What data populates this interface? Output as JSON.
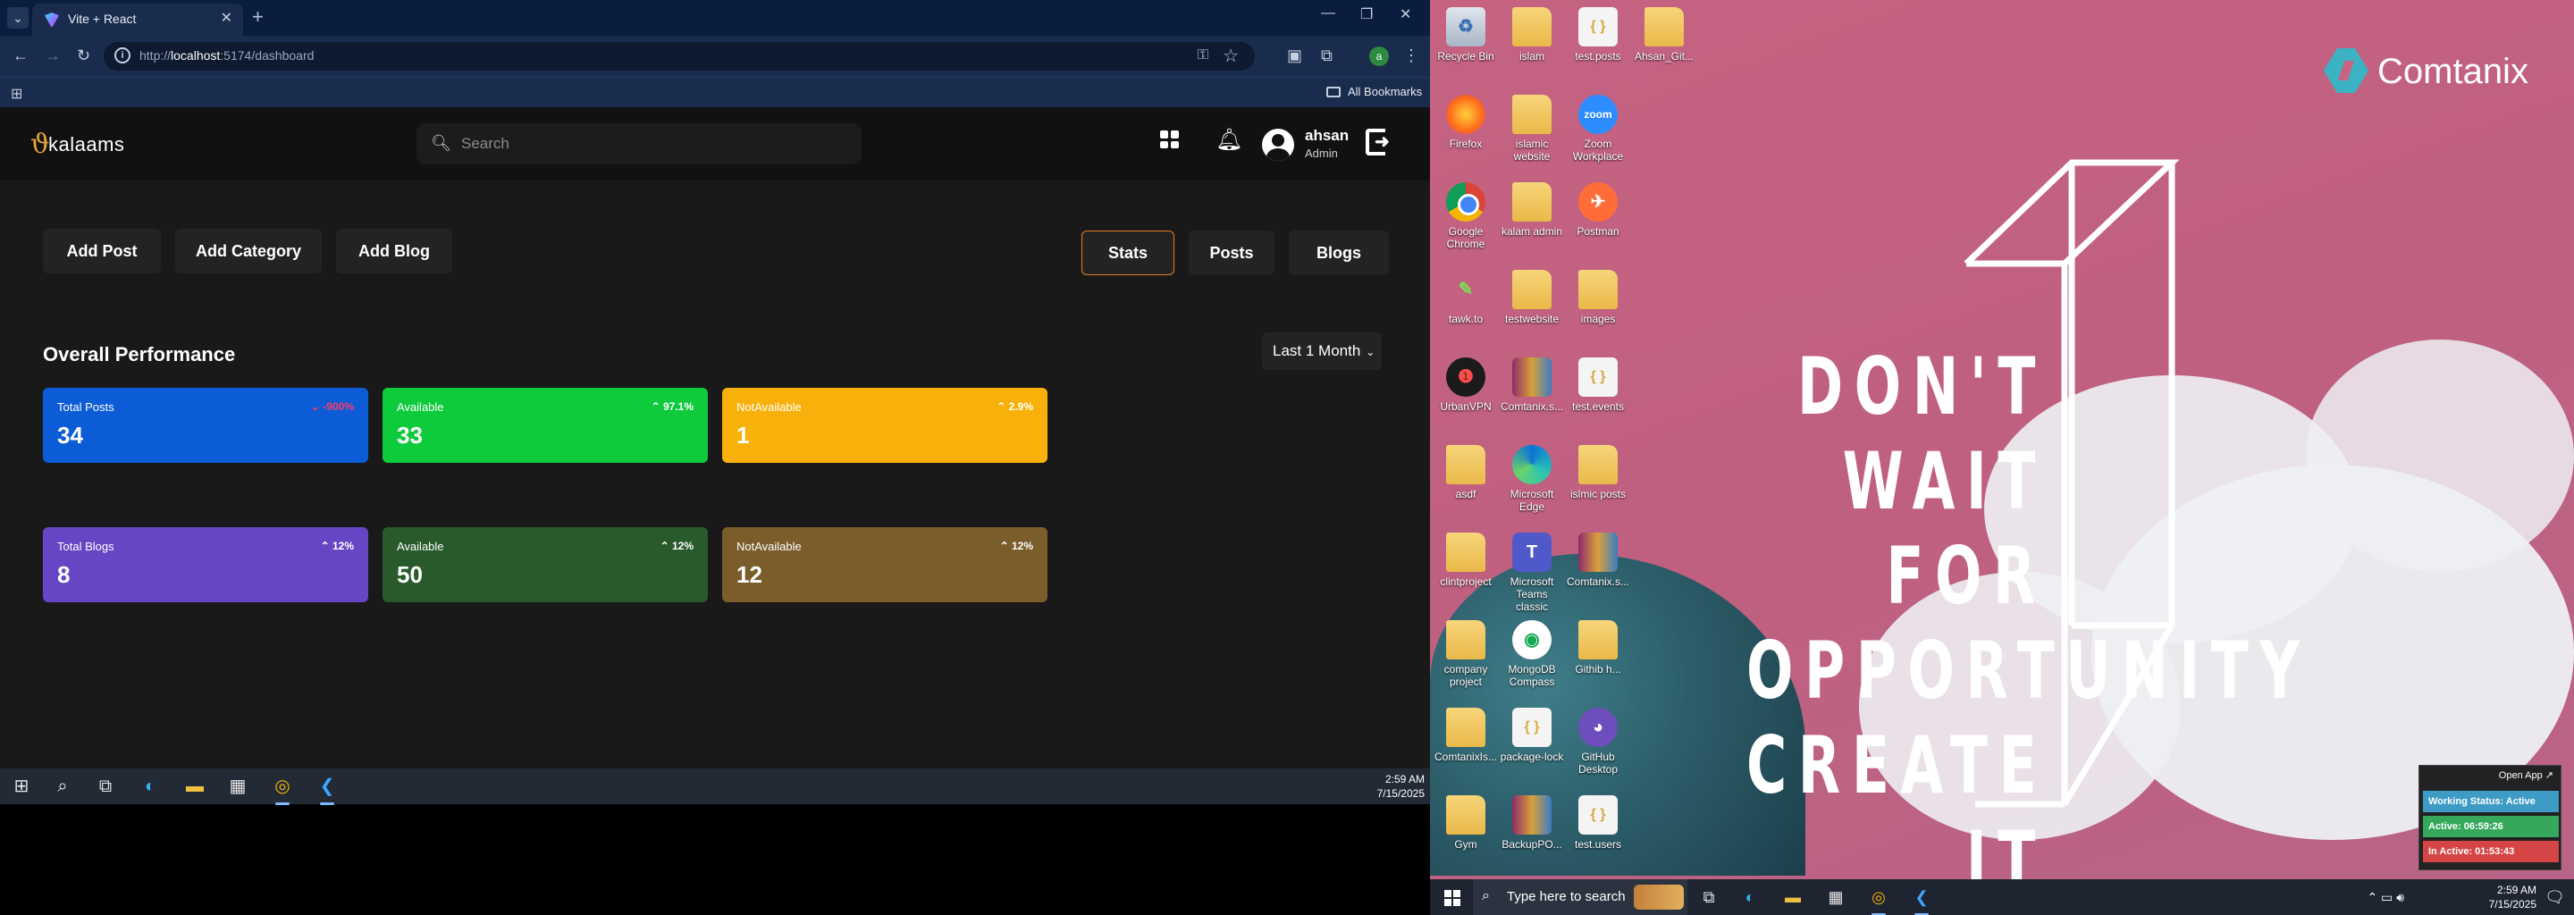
{
  "browser": {
    "tab_title": "Vite + React",
    "url_prefix": "http://",
    "url_host": "localhost",
    "url_path": ":5174/dashboard",
    "profile_initial": "a",
    "bookmarks_label": "All Bookmarks"
  },
  "app": {
    "logo_text": "kalaams",
    "search_placeholder": "Search",
    "user_name": "ahsan",
    "user_role": "Admin",
    "action_buttons": [
      "Add Post",
      "Add Category",
      "Add Blog"
    ],
    "tabs": [
      "Stats",
      "Posts",
      "Blogs"
    ],
    "active_tab": "Stats",
    "section_title": "Overall Performance",
    "range_label": "Last 1 Month",
    "cards": [
      {
        "label": "Total Posts",
        "value": "34",
        "change": "-900%",
        "trend": "down",
        "color": "#0b5cd6"
      },
      {
        "label": "Available",
        "value": "33",
        "change": "97.1%",
        "trend": "up",
        "color": "#0ecb3c"
      },
      {
        "label": "NotAvailable",
        "value": "1",
        "change": "2.9%",
        "trend": "up",
        "color": "#f7b10a"
      },
      {
        "label": "Total Blogs",
        "value": "8",
        "change": "12%",
        "trend": "up",
        "color": "#6646c4"
      },
      {
        "label": "Available",
        "value": "50",
        "change": "12%",
        "trend": "up",
        "color": "#295a2b"
      },
      {
        "label": "NotAvailable",
        "value": "12",
        "change": "12%",
        "trend": "up",
        "color": "#7b5d2c"
      }
    ]
  },
  "taskbar_left": {
    "time": "2:59 AM",
    "date": "7/15/2025"
  },
  "desktop": {
    "brand": "Comtanix",
    "quote_lines": [
      "DON'T",
      "WAIT FOR",
      "OPPORTUNITY",
      "CREATE IT"
    ],
    "icons": [
      {
        "label": "Recycle Bin",
        "kind": "bin",
        "glyph": "♻"
      },
      {
        "label": "islam",
        "kind": "folder",
        "glyph": ""
      },
      {
        "label": "test.posts",
        "kind": "file",
        "glyph": "{ }"
      },
      {
        "label": "Ahsan_Git...",
        "kind": "folder",
        "glyph": ""
      },
      {
        "label": "Firefox",
        "kind": "ff",
        "glyph": ""
      },
      {
        "label": "islamic website",
        "kind": "folder",
        "glyph": ""
      },
      {
        "label": "Zoom Workplace",
        "kind": "zoom",
        "glyph": "zoom"
      },
      {
        "label": "Google Chrome",
        "kind": "chrome",
        "glyph": ""
      },
      {
        "label": "kalam admin",
        "kind": "folder",
        "glyph": ""
      },
      {
        "label": "Postman",
        "kind": "postman",
        "glyph": "✈"
      },
      {
        "label": "tawk.to",
        "kind": "tawk",
        "glyph": "✎"
      },
      {
        "label": "testwebsite",
        "kind": "folder",
        "glyph": ""
      },
      {
        "label": "images",
        "kind": "folder",
        "glyph": ""
      },
      {
        "label": "UrbanVPN",
        "kind": "vpn",
        "glyph": "❶"
      },
      {
        "label": "Comtanix.s...",
        "kind": "rar",
        "glyph": ""
      },
      {
        "label": "test.events",
        "kind": "file",
        "glyph": "{ }"
      },
      {
        "label": "asdf",
        "kind": "folder",
        "glyph": ""
      },
      {
        "label": "Microsoft Edge",
        "kind": "edge",
        "glyph": ""
      },
      {
        "label": "islmic posts",
        "kind": "folder",
        "glyph": ""
      },
      {
        "label": "clintproject",
        "kind": "folder",
        "glyph": ""
      },
      {
        "label": "Microsoft Teams classic",
        "kind": "teams",
        "glyph": "T"
      },
      {
        "label": "Comtanix.s...",
        "kind": "rar",
        "glyph": ""
      },
      {
        "label": "company project",
        "kind": "folder",
        "glyph": ""
      },
      {
        "label": "MongoDB Compass",
        "kind": "mongo",
        "glyph": "◉"
      },
      {
        "label": "Githib h...",
        "kind": "folder",
        "glyph": ""
      },
      {
        "label": "ComtanixIs...",
        "kind": "folder",
        "glyph": ""
      },
      {
        "label": "package-lock",
        "kind": "file",
        "glyph": "{ }"
      },
      {
        "label": "GitHub Desktop",
        "kind": "gh",
        "glyph": "◕"
      },
      {
        "label": "Gym",
        "kind": "folder",
        "glyph": ""
      },
      {
        "label": "BackupPO...",
        "kind": "rar",
        "glyph": ""
      },
      {
        "label": "test.users",
        "kind": "file",
        "glyph": "{ }"
      }
    ]
  },
  "widget": {
    "open_app": "Open App ↗",
    "status": "Working Status: Active",
    "active": "Active: 06:59:26",
    "inactive": "In Active: 01:53:43"
  },
  "taskbar_right": {
    "search_text": "Type here to search",
    "time": "2:59 AM",
    "date": "7/15/2025"
  }
}
